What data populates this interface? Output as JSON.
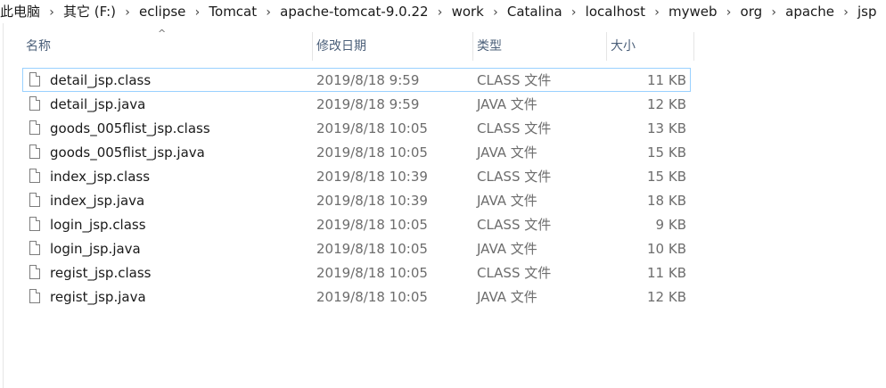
{
  "breadcrumb": [
    "此电脑",
    "其它 (F:)",
    "eclipse",
    "Tomcat",
    "apache-tomcat-9.0.22",
    "work",
    "Catalina",
    "localhost",
    "myweb",
    "org",
    "apache",
    "jsp"
  ],
  "breadcrumb_separator": "›",
  "columns": {
    "name": "名称",
    "date": "修改日期",
    "type": "类型",
    "size": "大小"
  },
  "sort_indicator": "^",
  "files": [
    {
      "name": "detail_jsp.class",
      "date": "2019/8/18 9:59",
      "type": "CLASS 文件",
      "size": "11 KB"
    },
    {
      "name": "detail_jsp.java",
      "date": "2019/8/18 9:59",
      "type": "JAVA 文件",
      "size": "12 KB"
    },
    {
      "name": "goods_005flist_jsp.class",
      "date": "2019/8/18 10:05",
      "type": "CLASS 文件",
      "size": "13 KB"
    },
    {
      "name": "goods_005flist_jsp.java",
      "date": "2019/8/18 10:05",
      "type": "JAVA 文件",
      "size": "15 KB"
    },
    {
      "name": "index_jsp.class",
      "date": "2019/8/18 10:39",
      "type": "CLASS 文件",
      "size": "15 KB"
    },
    {
      "name": "index_jsp.java",
      "date": "2019/8/18 10:39",
      "type": "JAVA 文件",
      "size": "18 KB"
    },
    {
      "name": "login_jsp.class",
      "date": "2019/8/18 10:05",
      "type": "CLASS 文件",
      "size": "9 KB"
    },
    {
      "name": "login_jsp.java",
      "date": "2019/8/18 10:05",
      "type": "JAVA 文件",
      "size": "10 KB"
    },
    {
      "name": "regist_jsp.class",
      "date": "2019/8/18 10:05",
      "type": "CLASS 文件",
      "size": "11 KB"
    },
    {
      "name": "regist_jsp.java",
      "date": "2019/8/18 10:05",
      "type": "JAVA 文件",
      "size": "12 KB"
    }
  ],
  "icons": {
    "file": "file-icon",
    "separator": "chevron-right-icon",
    "sort": "sort-ascending-icon"
  },
  "colors": {
    "focus_border": "#99d1ff",
    "header_text": "#4c607a",
    "secondary_text": "#6d6d6d"
  }
}
